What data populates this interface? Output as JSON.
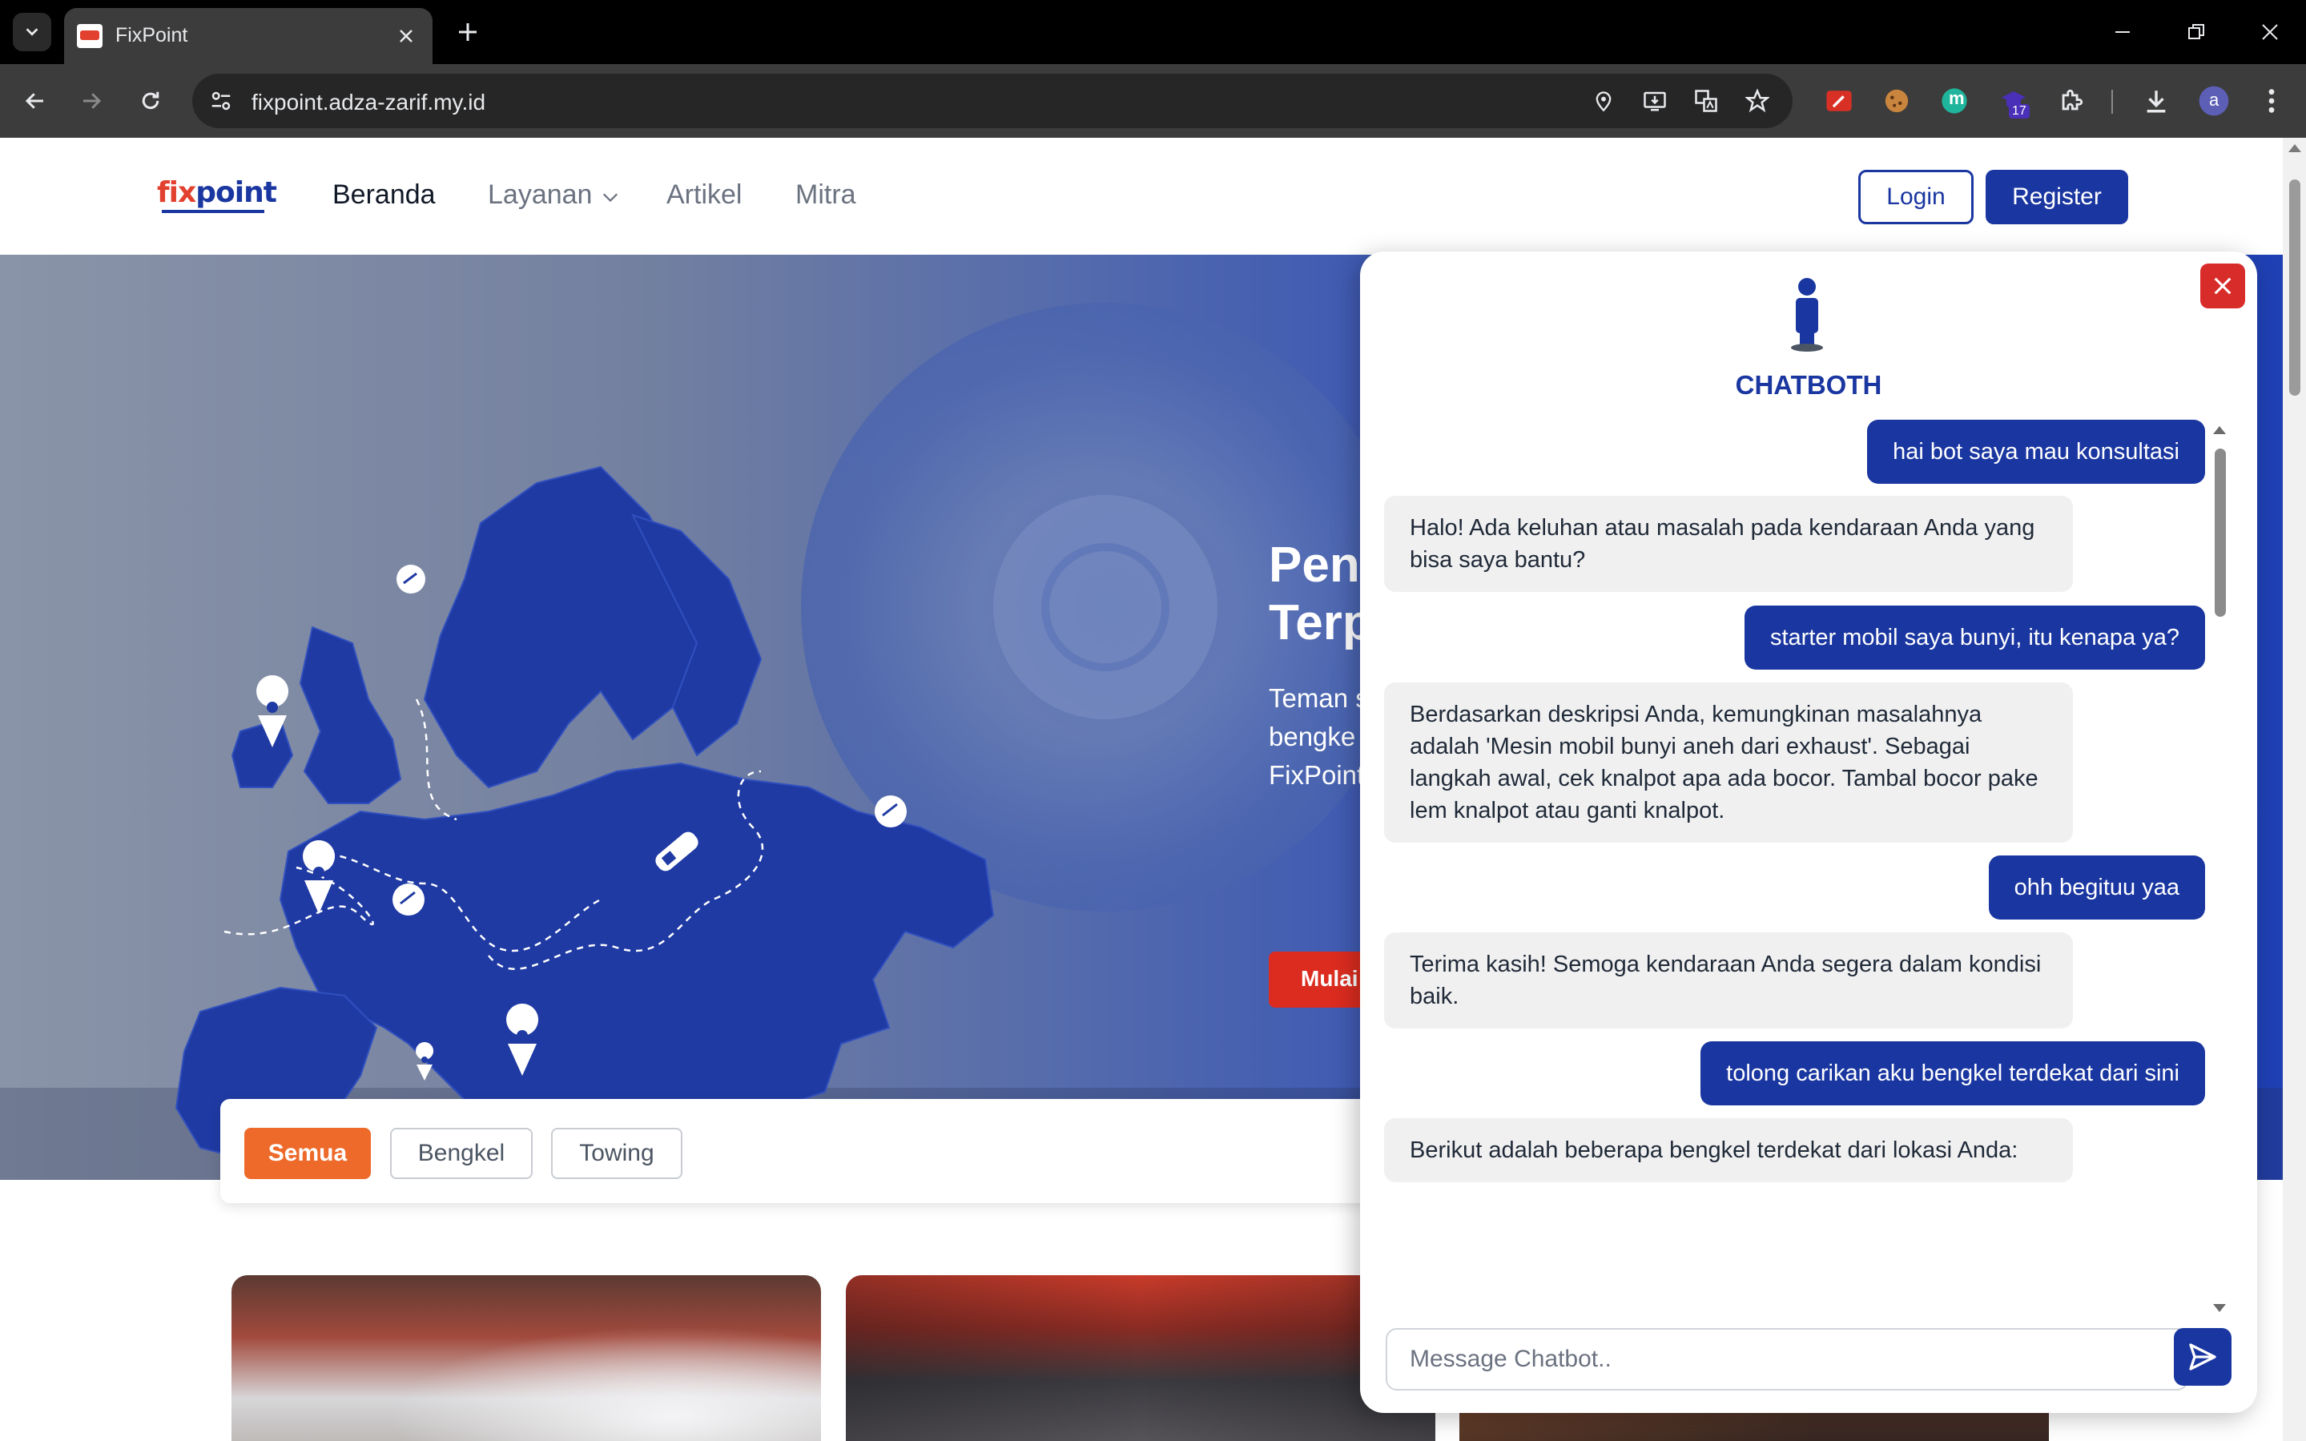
{
  "browser": {
    "tab_title": "FixPoint",
    "url": "fixpoint.adza-zarif.my.id",
    "extension_badge": "17",
    "profile_initial": "a",
    "ext_m_label": "m"
  },
  "site": {
    "logo_text_fix": "fix",
    "logo_text_point": "point",
    "nav": {
      "home": "Beranda",
      "services": "Layanan",
      "articles": "Artikel",
      "partners": "Mitra"
    },
    "login": "Login",
    "register": "Register"
  },
  "hero": {
    "title_line1": "Pen",
    "title_line2": "Terp",
    "desc_line1": "Teman s",
    "desc_line2": "bengke",
    "desc_line3": "FixPoint",
    "cta": "Mulai"
  },
  "filters": {
    "all": "Semua",
    "workshop": "Bengkel",
    "towing": "Towing"
  },
  "chat": {
    "title": "CHATBOTH",
    "input_placeholder": "Message Chatbot..",
    "messages": [
      {
        "from": "user",
        "text": "hai bot saya mau konsultasi"
      },
      {
        "from": "bot",
        "text": "Halo! Ada keluhan atau masalah pada kendaraan Anda yang bisa saya bantu?"
      },
      {
        "from": "user",
        "text": "starter mobil saya bunyi, itu kenapa ya?"
      },
      {
        "from": "bot",
        "text": "Berdasarkan deskripsi Anda, kemungkinan masalahnya adalah 'Mesin mobil bunyi aneh dari exhaust'. Sebagai langkah awal, cek knalpot apa ada bocor. Tambal bocor pake lem knalpot atau ganti knalpot."
      },
      {
        "from": "user",
        "text": "ohh begituu yaa"
      },
      {
        "from": "bot",
        "text": "Terima kasih! Semoga kendaraan Anda segera dalam kondisi baik."
      },
      {
        "from": "user",
        "text": "tolong carikan aku bengkel terdekat dari sini"
      },
      {
        "from": "bot",
        "text": "Berikut adalah beberapa bengkel terdekat dari lokasi Anda:"
      }
    ]
  },
  "colors": {
    "brand_blue": "#1a36a0",
    "accent_orange": "#ee6a2a",
    "danger_red": "#d82c2a",
    "logo_red": "#e2412f"
  }
}
